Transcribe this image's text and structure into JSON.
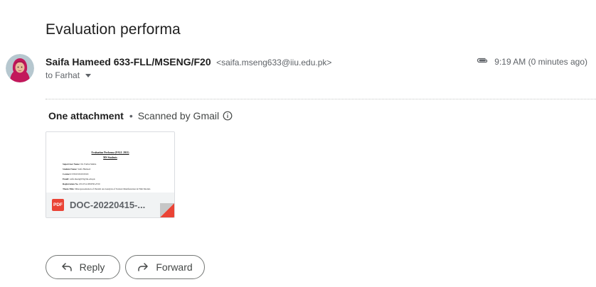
{
  "email": {
    "subject": "Evaluation performa",
    "sender_name": "Saifa Hameed 633-FLL/MSENG/F20",
    "sender_email": "<saifa.mseng633@iiu.edu.pk>",
    "recipient": "to Farhat",
    "time": "9:19 AM (0 minutes ago)"
  },
  "attachments": {
    "count_label": "One attachment",
    "separator": "•",
    "scan_label": "Scanned by Gmail",
    "file": {
      "name": "DOC-20220415-...",
      "type_badge": "PDF",
      "preview": {
        "title": "Evaluation Performa (FALL 2021)",
        "subtitle": "MS Students",
        "lines": [
          {
            "label": "Supervisor Name:",
            "value": "Dr. Farhat Mehta"
          },
          {
            "label": "Student Name:",
            "value": "Saifa Hameed"
          },
          {
            "label": "Contact:",
            "value": "03XXXXXXXXX"
          },
          {
            "label": "Email:",
            "value": "saifa.mseng633@iiu.edu.pk"
          },
          {
            "label": "Registration No.",
            "value": "633-FLL/MSENG/F20"
          },
          {
            "label": "Thesis Title:",
            "value": "Misrepresentation of Punish: An Analysis of Textual Manifestation in Film Models"
          }
        ]
      }
    }
  },
  "actions": {
    "reply_label": "Reply",
    "forward_label": "Forward"
  },
  "icons": {
    "attachment": "paperclip-icon",
    "info": "info-icon",
    "reply": "reply-arrow-icon",
    "forward": "forward-arrow-icon",
    "dropdown": "caret-down-icon"
  },
  "colors": {
    "pdf_red": "#ea4335",
    "text_primary": "#1f1f1f",
    "text_secondary": "#5f6368"
  }
}
